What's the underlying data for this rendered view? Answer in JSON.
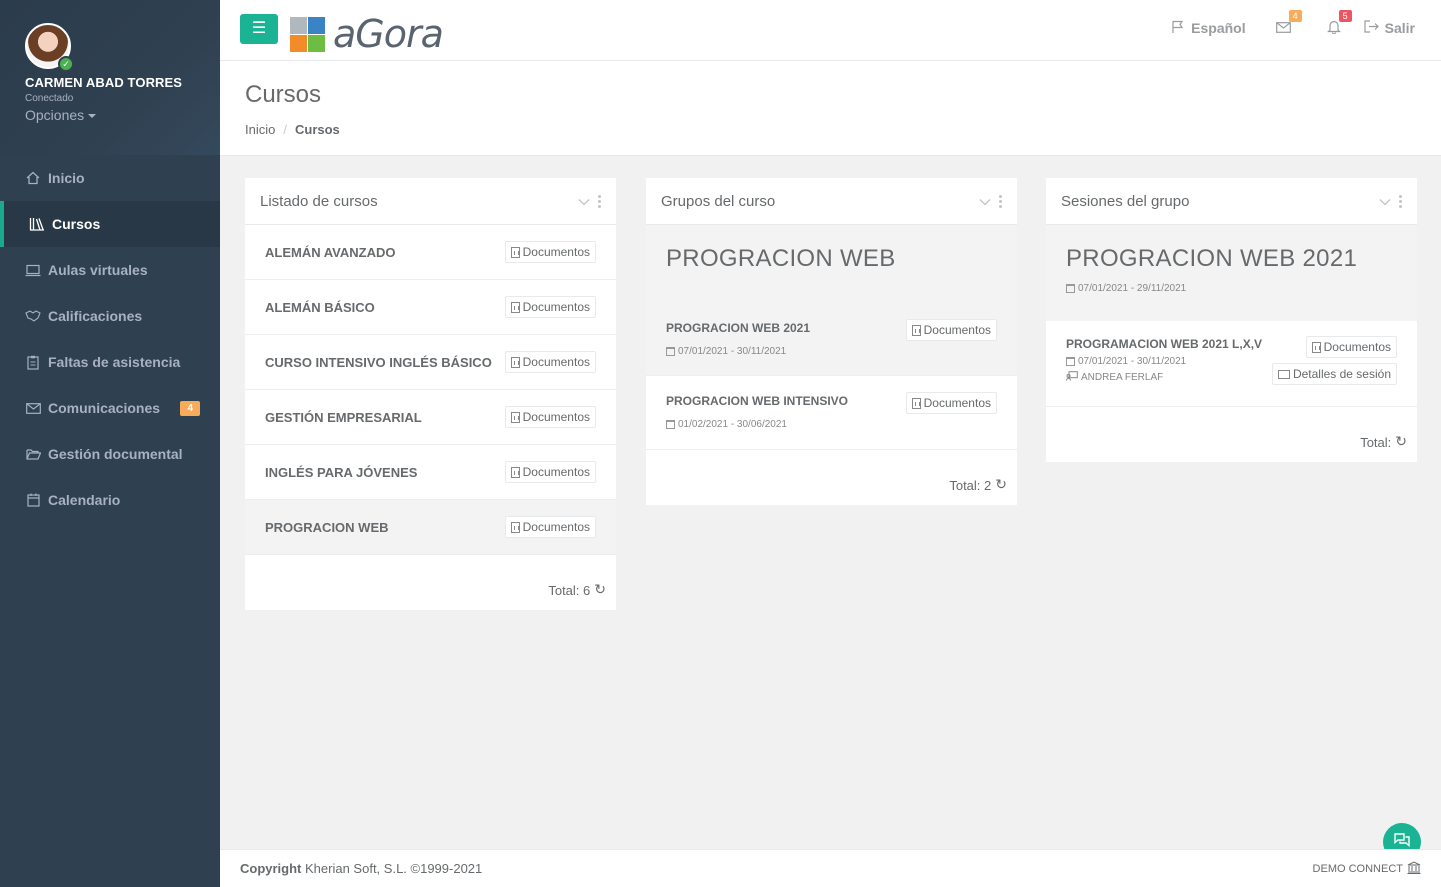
{
  "user": {
    "name": "CARMEN ABAD TORRES",
    "status": "Conectado",
    "options_label": "Opciones"
  },
  "sidebar": {
    "items": [
      {
        "label": "Inicio",
        "icon": "home-icon"
      },
      {
        "label": "Cursos",
        "icon": "books-icon",
        "active": true
      },
      {
        "label": "Aulas virtuales",
        "icon": "laptop-icon"
      },
      {
        "label": "Calificaciones",
        "icon": "handshake-icon"
      },
      {
        "label": "Faltas de asistencia",
        "icon": "clipboard-icon"
      },
      {
        "label": "Comunicaciones",
        "icon": "envelope-icon",
        "badge": "4"
      },
      {
        "label": "Gestión documental",
        "icon": "folder-open-icon"
      },
      {
        "label": "Calendario",
        "icon": "calendar-icon"
      }
    ]
  },
  "topbar": {
    "logo_text": "aGora",
    "language": "Español",
    "mail_count": "4",
    "notification_count": "5",
    "logout": "Salir"
  },
  "page": {
    "title": "Cursos",
    "breadcrumb": {
      "home": "Inicio",
      "sep": "/",
      "current": "Cursos"
    }
  },
  "courses_panel": {
    "title": "Listado de cursos",
    "doc_label": "Documentos",
    "items": [
      "ALEMÁN AVANZADO",
      "ALEMÁN BÁSICO",
      "CURSO INTENSIVO INGLÉS BÁSICO",
      "GESTIÓN EMPRESARIAL",
      "INGLÉS PARA JÓVENES",
      "PROGRACION WEB"
    ],
    "total": "Total: 6"
  },
  "groups_panel": {
    "title": "Grupos del curso",
    "course_name": "PROGRACION WEB",
    "doc_label": "Documentos",
    "items": [
      {
        "name": "PROGRACION WEB 2021",
        "dates": "07/01/2021 - 30/11/2021"
      },
      {
        "name": "PROGRACION WEB INTENSIVO",
        "dates": "01/02/2021 - 30/06/2021"
      }
    ],
    "total": "Total: 2"
  },
  "sessions_panel": {
    "title": "Sesiones del grupo",
    "group_name": "PROGRACION WEB 2021",
    "group_dates": "07/01/2021 - 29/11/2021",
    "session": {
      "name": "PROGRAMACION WEB 2021 L,X,V",
      "dates": "07/01/2021 - 30/11/2021",
      "teacher": "ANDREA FERLAF",
      "doc_label": "Documentos",
      "details_label": "Detalles de sesión"
    },
    "total": "Total:"
  },
  "footer": {
    "copyright_bold": "Copyright",
    "copyright_text": "Kherian Soft, S.L. ©1999-2021",
    "right_text": "DEMO CONNECT"
  },
  "colors": {
    "accent": "#1ab394",
    "sidebar": "#2f4050",
    "badge_orange": "#f8ac59",
    "badge_red": "#ed5565"
  }
}
